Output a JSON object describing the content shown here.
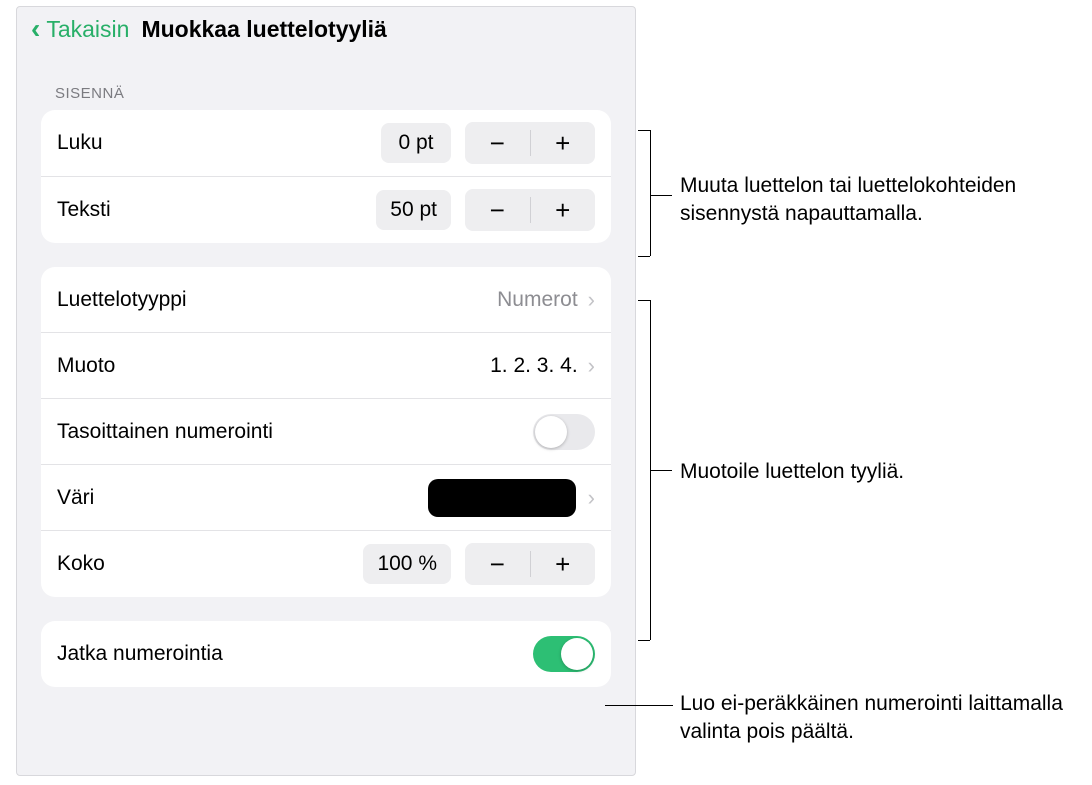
{
  "header": {
    "back_label": "Takaisin",
    "title": "Muokkaa luettelotyyliä"
  },
  "indent_section": {
    "label": "SISENNÄ",
    "chapter_label": "Luku",
    "chapter_value": "0 pt",
    "text_label": "Teksti",
    "text_value": "50 pt"
  },
  "style_section": {
    "list_type_label": "Luettelotyyppi",
    "list_type_value": "Numerot",
    "format_label": "Muoto",
    "format_value": "1. 2. 3. 4.",
    "tiered_label": "Tasoittainen numerointi",
    "color_label": "Väri",
    "size_label": "Koko",
    "size_value": "100 %"
  },
  "continue_section": {
    "label": "Jatka numerointia"
  },
  "callouts": {
    "c1": "Muuta luettelon tai luettelokohteiden sisennystä napauttamalla.",
    "c2": "Muotoile luettelon tyyliä.",
    "c3": "Luo ei-peräkkäinen numerointi laittamalla valinta pois päältä."
  }
}
